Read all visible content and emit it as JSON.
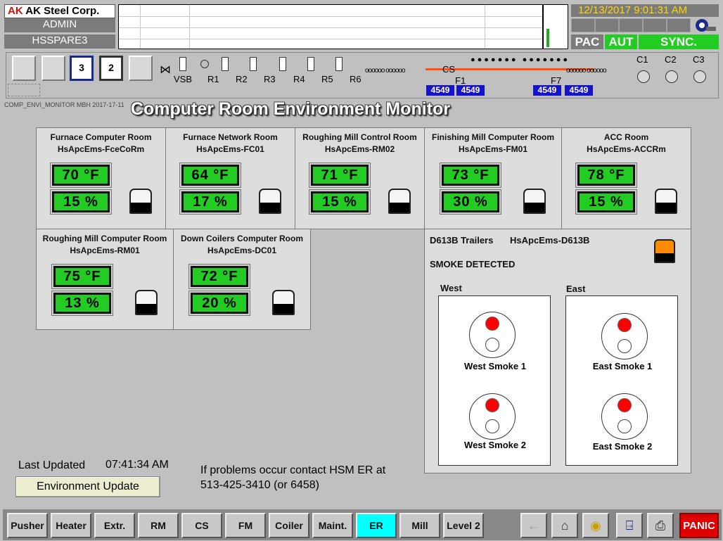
{
  "header": {
    "logo": "AK Steel Corp.",
    "user": "ADMIN",
    "host": "HSSPARE3",
    "datetime": "12/13/2017   9:01:31 AM",
    "status": {
      "pac": "PAC",
      "aut": "AUT",
      "sync": "SYNC."
    },
    "colors": {
      "pac_bg": "#7b7b7b",
      "aut_bg": "#22cc22",
      "sync_bg": "#22cc22",
      "date_text": "#ffd700"
    }
  },
  "mill": {
    "screens": [
      "3",
      "2"
    ],
    "labels": {
      "vsb": "VSB",
      "r1": "R1",
      "r2": "R2",
      "r3": "R3",
      "r4": "R4",
      "r5": "R5",
      "r6": "R6",
      "cs": "CS",
      "f1": "F1",
      "f7": "F7",
      "c1": "C1",
      "c2": "C2",
      "c3": "C3"
    },
    "counts": [
      "4549",
      "4549",
      "4549",
      "4549"
    ]
  },
  "page_tag": "COMP_ENVI_MONITOR MBH 2017-17-11",
  "title": "Computer Room Environment Monitor",
  "rooms": [
    {
      "name": "Furnace Computer Room",
      "id": "HsApcEms-FceCoRm",
      "temp": "70 °F",
      "humidity": "15 %"
    },
    {
      "name": "Furnace Network Room",
      "id": "HsApcEms-FC01",
      "temp": "64 °F",
      "humidity": "17 %"
    },
    {
      "name": "Roughing Mill Control Room",
      "id": "HsApcEms-RM02",
      "temp": "71 °F",
      "humidity": "15 %"
    },
    {
      "name": "Finishing Mill Computer Room",
      "id": "HsApcEms-FM01",
      "temp": "73 °F",
      "humidity": "30 %"
    },
    {
      "name": "ACC Room",
      "id": "HsApcEms-ACCRm",
      "temp": "78 °F",
      "humidity": "15 %"
    },
    {
      "name": "Roughing Mill Computer Room",
      "id": "HsApcEms-RM01",
      "temp": "75 °F",
      "humidity": "13 %"
    },
    {
      "name": "Down Coilers Computer Room",
      "id": "HsApcEms-DC01",
      "temp": "72 °F",
      "humidity": "20 %"
    }
  ],
  "smoke": {
    "trailer": "D613B Trailers",
    "id": "HsApcEms-D613B",
    "status": "SMOKE DETECTED",
    "west": "West",
    "east": "East",
    "detectors": [
      "West Smoke 1",
      "West Smoke 2",
      "East Smoke 1",
      "East Smoke 2"
    ],
    "alarm_color": "#ff8c00"
  },
  "footer": {
    "last_updated_label": "Last Updated",
    "last_updated_time": "07:41:34 AM",
    "env_button": "Environment Update",
    "contact_line1": "If problems occur contact HSM ER at",
    "contact_line2": "513-425-3410 (or 6458)"
  },
  "nav": {
    "buttons": [
      "Pusher",
      "Heater",
      "Extr.",
      "RM",
      "CS",
      "FM",
      "Coiler",
      "Maint.",
      "ER",
      "Mill",
      "Level 2"
    ],
    "active": "ER",
    "icons": [
      "back-arrow-icon",
      "home-icon",
      "cd-icon",
      "exit-door-icon",
      "printer-icon"
    ],
    "panic": "PANIC"
  }
}
